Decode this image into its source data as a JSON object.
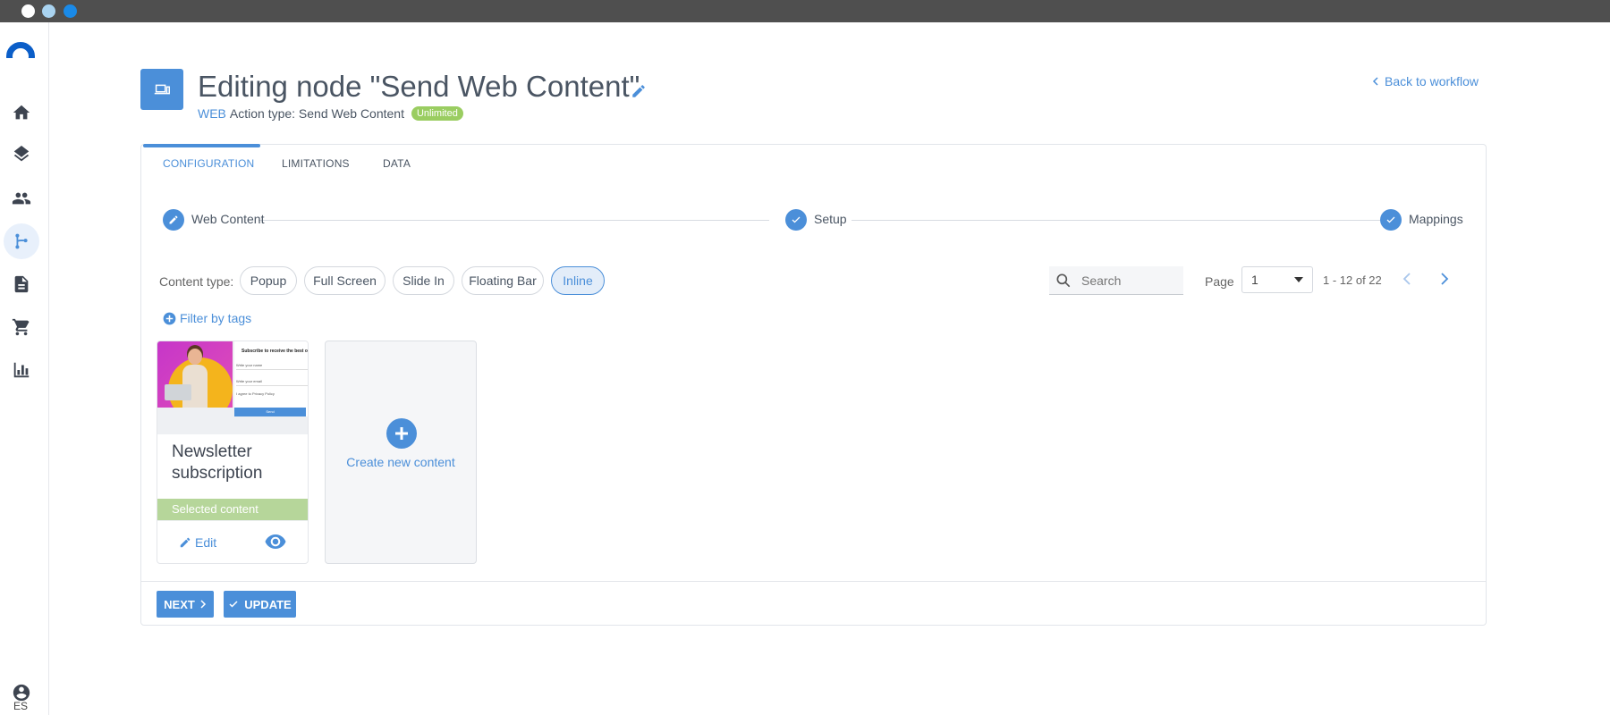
{
  "sidebar": {
    "items": [
      {
        "icon": "home-icon"
      },
      {
        "icon": "layers-icon"
      },
      {
        "icon": "people-icon"
      },
      {
        "icon": "workflow-icon"
      },
      {
        "icon": "document-icon"
      },
      {
        "icon": "cart-icon"
      },
      {
        "icon": "chart-icon"
      }
    ],
    "language": "ES"
  },
  "header": {
    "title": "Editing node \"Send Web Content\"",
    "channel": "WEB",
    "action_type": "Action type: Send Web Content",
    "badge": "Unlimited",
    "back_link": "Back to workflow"
  },
  "tabs": [
    {
      "label": "CONFIGURATION"
    },
    {
      "label": "LIMITATIONS"
    },
    {
      "label": "DATA"
    }
  ],
  "steps": [
    {
      "label": "Web Content"
    },
    {
      "label": "Setup"
    },
    {
      "label": "Mappings"
    }
  ],
  "content_type": {
    "label": "Content type:",
    "options": [
      "Popup",
      "Full Screen",
      "Slide In",
      "Floating Bar",
      "Inline"
    ],
    "selected": "Inline"
  },
  "search": {
    "placeholder": "Search"
  },
  "pagination": {
    "label": "Page",
    "current": "1",
    "range": "1 - 12 of 22"
  },
  "filter": {
    "label": "Filter by tags"
  },
  "content_card": {
    "title": "Newsletter subscription",
    "selected_label": "Selected content",
    "edit_label": "Edit",
    "preview": {
      "heading": "Subscribe to receive the best of",
      "name_placeholder": "Write your name",
      "email_placeholder": "Write your email",
      "checkbox": "I agree to Privacy Policy",
      "button": "Send"
    }
  },
  "new_content": {
    "label": "Create new content"
  },
  "footer": {
    "next": "NEXT",
    "update": "UPDATE"
  },
  "colors": {
    "accent": "#4b8fd9",
    "badge": "#9acd61",
    "selected": "#b6d69a"
  }
}
